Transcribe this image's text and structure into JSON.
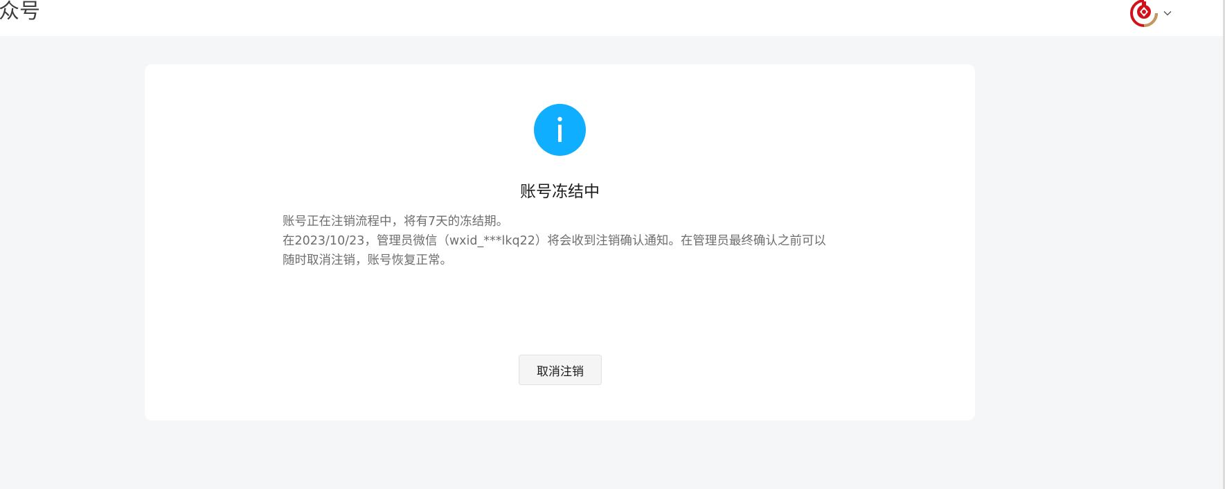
{
  "header": {
    "brand_text": "众号",
    "account_menu": {
      "avatar_icon": "seal-logo-icon",
      "dropdown_icon": "chevron-down-icon"
    }
  },
  "notice": {
    "icon": "info-icon",
    "icon_color": "#10aeff",
    "title": "账号冻结中",
    "lines": [
      "账号正在注销流程中，将有7天的冻结期。",
      "在2023/10/23，管理员微信（wxid_***lkq22）将会收到注销确认通知。在管理员最终确认之前可以随时取消注销，账号恢复正常。"
    ],
    "cancel_button_label": "取消注销"
  },
  "colors": {
    "page_background": "#f5f6f7",
    "card_background": "#ffffff",
    "avatar_red": "#d3101a",
    "avatar_gold": "#c19a62"
  }
}
